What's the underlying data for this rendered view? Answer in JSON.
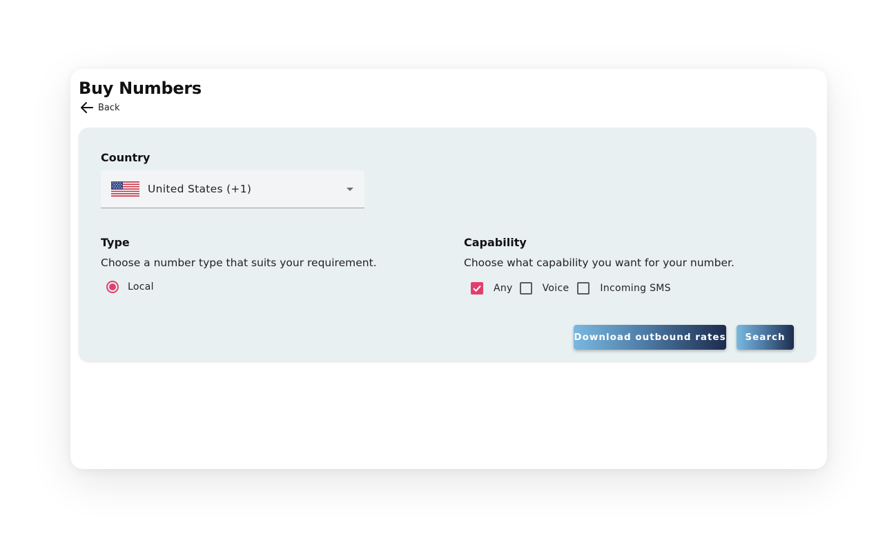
{
  "page": {
    "title": "Buy Numbers",
    "back_label": "Back"
  },
  "country": {
    "label": "Country",
    "selected": "United States (+1)",
    "flag_icon": "us-flag-icon"
  },
  "type": {
    "label": "Type",
    "description": "Choose a number type that suits your requirement.",
    "options": [
      {
        "label": "Local",
        "selected": true
      }
    ]
  },
  "capability": {
    "label": "Capability",
    "description": "Choose what capability you want for your number.",
    "options": [
      {
        "label": "Any",
        "checked": true
      },
      {
        "label": "Voice",
        "checked": false
      },
      {
        "label": "Incoming SMS",
        "checked": false
      }
    ]
  },
  "actions": {
    "download_label": "Download outbound rates",
    "search_label": "Search"
  },
  "colors": {
    "accent": "#e0406e",
    "panel_bg": "#e9f0f2",
    "button_gradient_start": "#79b8e0",
    "button_gradient_end": "#1d2c4e"
  }
}
